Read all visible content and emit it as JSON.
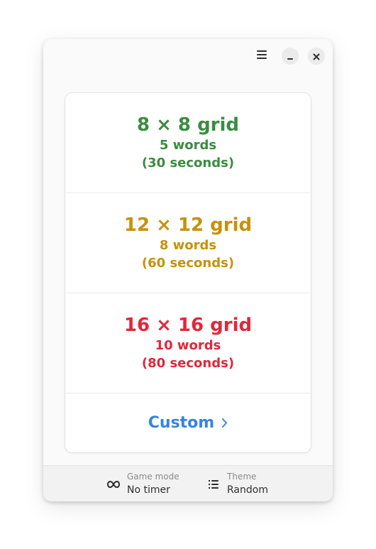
{
  "header": {
    "menu_icon": "hamburger-menu-icon",
    "minimize_icon": "minimize-icon",
    "close_icon": "close-icon"
  },
  "options": [
    {
      "title": "8 × 8 grid",
      "words": "5 words",
      "seconds": "(30 seconds)",
      "color": "#3a8c3f"
    },
    {
      "title": "12 × 12 grid",
      "words": "8 words",
      "seconds": "(60 seconds)",
      "color": "#c89108"
    },
    {
      "title": "16 × 16 grid",
      "words": "10 words",
      "seconds": "(80 seconds)",
      "color": "#e0283b"
    }
  ],
  "custom": {
    "label": "Custom",
    "color": "#3584e4",
    "icon": "chevron-right-icon"
  },
  "bottom_bar": {
    "game_mode": {
      "caption": "Game mode",
      "value": "No timer",
      "icon": "infinity-icon"
    },
    "theme": {
      "caption": "Theme",
      "value": "Random",
      "icon": "list-icon"
    }
  }
}
